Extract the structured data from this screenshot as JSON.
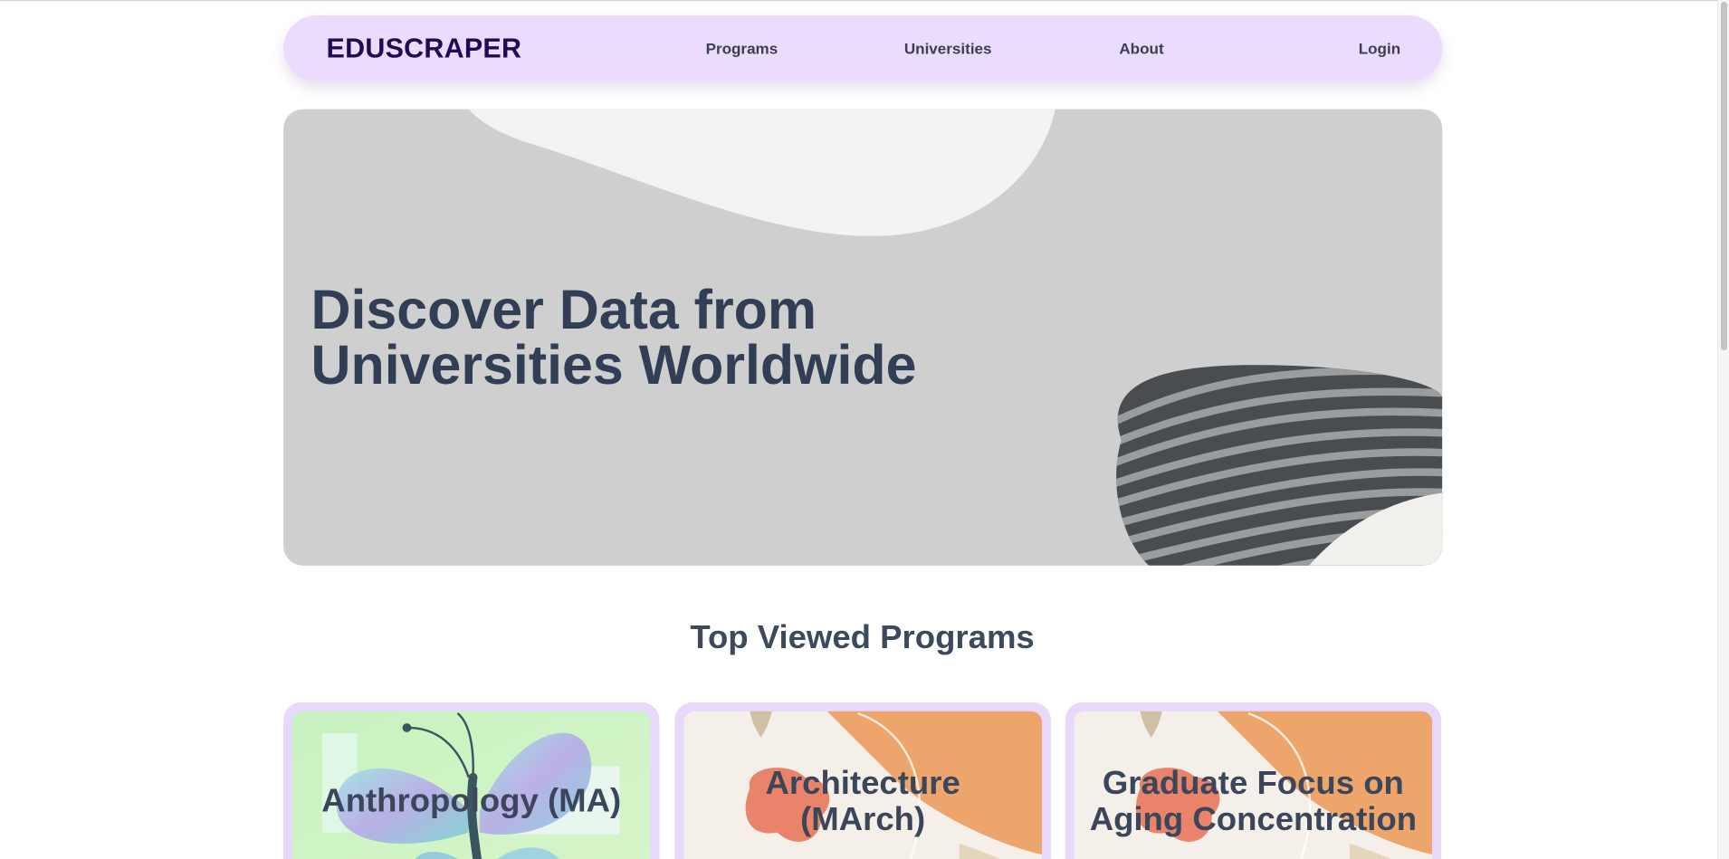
{
  "header": {
    "brand": "EDUSCRAPER",
    "nav": [
      {
        "label": "Programs"
      },
      {
        "label": "Universities"
      },
      {
        "label": "About"
      },
      {
        "label": "Login"
      }
    ]
  },
  "hero": {
    "title_line1": "Discover Data from",
    "title_line2": "Universities Worldwide"
  },
  "top_programs": {
    "heading": "Top Viewed Programs",
    "cards": [
      {
        "title": "Anthropology (MA)"
      },
      {
        "title_line1": "Architecture",
        "title_line2": "(MArch)"
      },
      {
        "title_line1": "Graduate Focus on",
        "title_line2": "Aging Concentration"
      }
    ]
  },
  "colors": {
    "navbar_bg": "#ebdcfd",
    "brand": "#1e0b52",
    "hero_bg": "#cfcfcf",
    "hero_text": "#313e55",
    "card_frame": "#e7d9fb"
  }
}
